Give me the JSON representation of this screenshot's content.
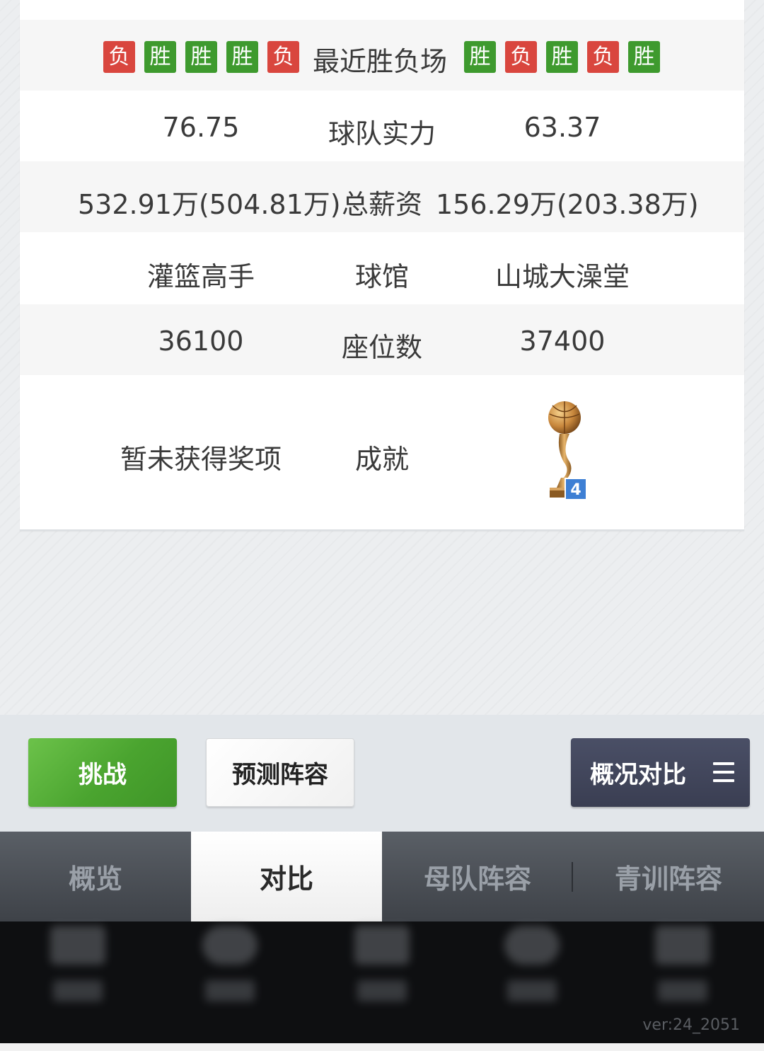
{
  "recent_results": {
    "left": [
      "负",
      "胜",
      "胜",
      "胜",
      "负"
    ],
    "label": "最近胜负场",
    "right": [
      "胜",
      "负",
      "胜",
      "负",
      "胜"
    ]
  },
  "rows": {
    "strength": {
      "left": "76.75",
      "label": "球队实力",
      "right": "63.37"
    },
    "salary": {
      "left": "532.91万(504.81万)",
      "label": "总薪资",
      "right": "156.29万(203.38万)"
    },
    "arena": {
      "left": "灌篮高手",
      "label": "球馆",
      "right": "山城大澡堂"
    },
    "seats": {
      "left": "36100",
      "label": "座位数",
      "right": "37400"
    },
    "achievements": {
      "left": "暂未获得奖项",
      "label": "成就",
      "trophy_count": "4"
    }
  },
  "actions": {
    "challenge": "挑战",
    "predict": "预测阵容",
    "overview_compare": "概况对比"
  },
  "tabs": [
    "概览",
    "对比",
    "母队阵容",
    "青训阵容"
  ],
  "active_tab": "对比",
  "version": "ver:24_2051",
  "colors": {
    "win": "#3e9a2e",
    "loss": "#d9463e",
    "challenge_green": "#4aa42f",
    "overview_navy": "#3a3e52"
  }
}
